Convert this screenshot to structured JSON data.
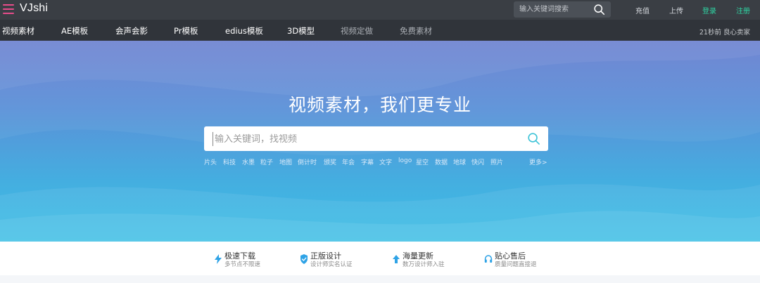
{
  "topbar": {
    "logo": "VJshi",
    "search_placeholder": "输入关键词搜索",
    "links": [
      "充值",
      "上传",
      "登录",
      "注册"
    ]
  },
  "nav": {
    "items": [
      "视频素材",
      "AE模板",
      "会声会影",
      "Pr模板",
      "edius模板",
      "3D模型",
      "视频定做",
      "免费素材"
    ],
    "ticker": "21秒前 良心卖家"
  },
  "hero": {
    "title": "视频素材，我们更专业",
    "search_placeholder": "输入关键词，找视频",
    "tags": [
      "片头",
      "科技",
      "水墨",
      "粒子",
      "地图",
      "倒计时",
      "颁奖",
      "年会",
      "字幕",
      "文字",
      "logo",
      "星空",
      "数据",
      "地球",
      "快闪",
      "照片"
    ],
    "more": "更多>"
  },
  "features": [
    {
      "title": "极速下载",
      "sub": "多节点不限速",
      "icon": "lightning-icon"
    },
    {
      "title": "正版设计",
      "sub": "设计师实名认证",
      "icon": "shield-check-icon"
    },
    {
      "title": "海量更新",
      "sub": "数万设计师入驻",
      "icon": "arrow-up-icon"
    },
    {
      "title": "贴心售后",
      "sub": "质量问题直接退",
      "icon": "headset-icon"
    }
  ],
  "colors": {
    "topbar_bg": "#3a3e44",
    "navbar_bg": "#30343a",
    "accent_green": "#2fd6a4",
    "menu_pink": "#e84c8b",
    "icon_blue": "#2fa3e6",
    "hero_top": "#6a7fd0",
    "hero_bottom": "#3ec0e6"
  }
}
